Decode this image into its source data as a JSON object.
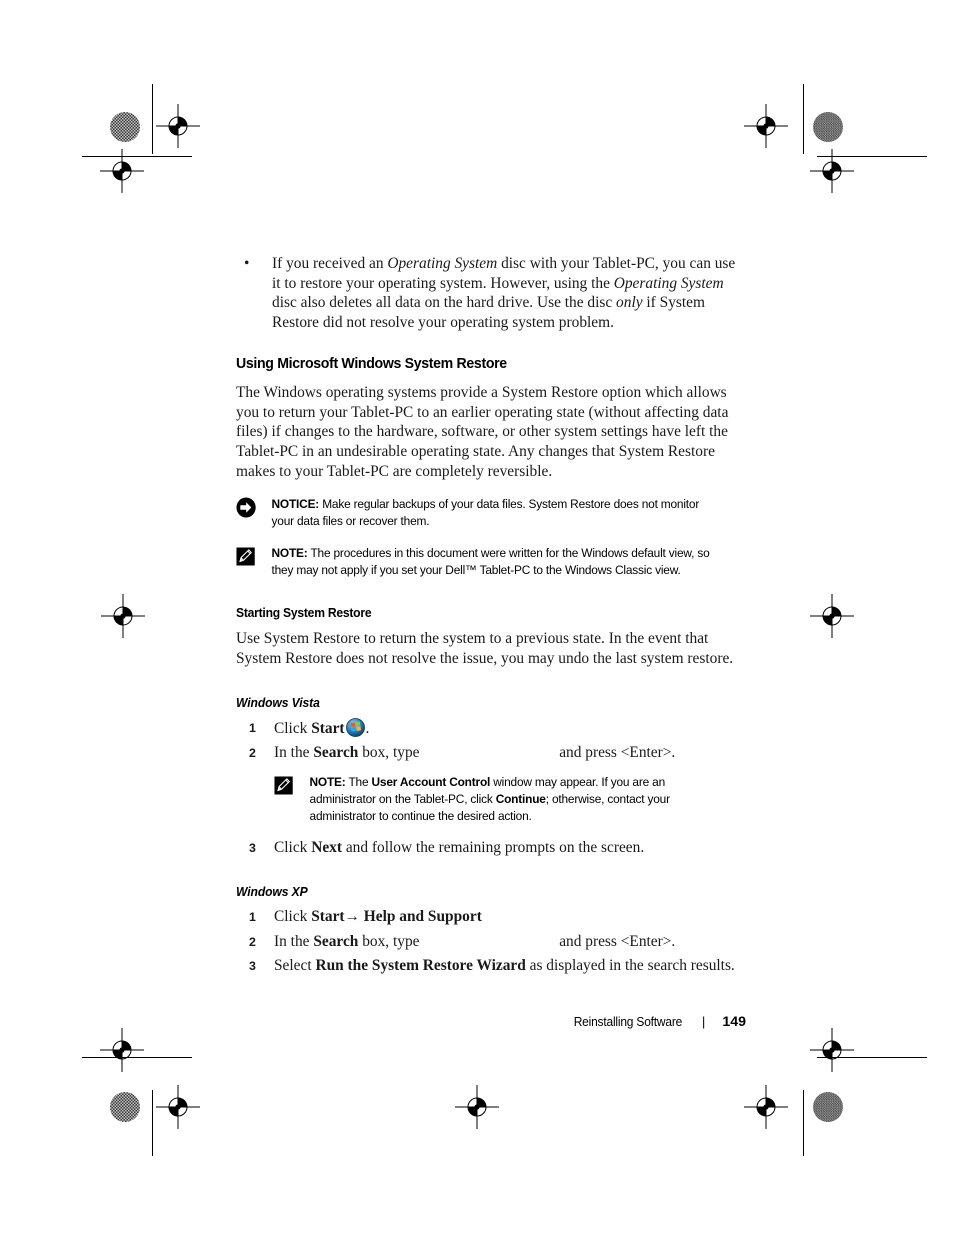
{
  "document": {
    "type": "dell-user-guide-page",
    "footer": {
      "section_title": "Reinstalling Software",
      "separator": "|",
      "page_number": "149"
    }
  },
  "content": {
    "bullets": [
      {
        "marker": "•",
        "runs": [
          {
            "text": "If you received an ",
            "style": "normal"
          },
          {
            "text": "Operating System",
            "style": "italic"
          },
          {
            "text": " disc with your Tablet-PC, you can use it to restore your operating system. However, using the ",
            "style": "normal"
          },
          {
            "text": "Operating System",
            "style": "italic"
          },
          {
            "text": " disc also deletes all data on the hard drive. Use the disc ",
            "style": "normal"
          },
          {
            "text": "only",
            "style": "italic"
          },
          {
            "text": " if System Restore did not resolve your operating system problem.",
            "style": "normal"
          }
        ]
      }
    ],
    "section_heading": "Using Microsoft Windows System Restore",
    "intro_paragraph": "The Windows operating systems provide a System Restore option which allows you to return your Tablet-PC to an earlier operating state (without affecting data files) if changes to the hardware, software, or other system settings have left the Tablet-PC in an undesirable operating state. Any changes that System Restore makes to your Tablet-PC are completely reversible.",
    "notice_callout": {
      "icon": "notice-arrow-icon",
      "label": "NOTICE:",
      "text": " Make regular backups of your data files. System Restore does not monitor your data files or recover them."
    },
    "note_callout": {
      "icon": "note-pencil-icon",
      "label": "NOTE:",
      "text": " The procedures in this document were written for the Windows default view, so they may not apply if you set your Dell™ Tablet-PC to the Windows Classic view."
    },
    "sub_heading": "Starting System Restore",
    "sub_paragraph": "Use System Restore to return the system to a previous state. In the event that System Restore does not resolve the issue, you may undo the last system restore.",
    "vista": {
      "heading": "Windows Vista",
      "steps": [
        {
          "num": "1",
          "runs": [
            {
              "text": "Click ",
              "style": "normal"
            },
            {
              "text": "Start",
              "style": "bold"
            },
            {
              "text": "",
              "style": "vista-orb-icon"
            },
            {
              "text": ".",
              "style": "normal"
            }
          ]
        },
        {
          "num": "2",
          "runs": [
            {
              "text": "In the ",
              "style": "normal"
            },
            {
              "text": "Search",
              "style": "bold"
            },
            {
              "text": " box, type ",
              "style": "normal"
            },
            {
              "text": "",
              "style": "blank-gap"
            },
            {
              "text": " and press <Enter>.",
              "style": "normal"
            }
          ],
          "note": {
            "icon": "note-pencil-icon",
            "label": "NOTE:",
            "runs": [
              {
                "text": " The ",
                "style": "normal"
              },
              {
                "text": "User Account Control",
                "style": "bold"
              },
              {
                "text": " window may appear. If you are an administrator on the Tablet-PC, click ",
                "style": "normal"
              },
              {
                "text": "Continue",
                "style": "bold"
              },
              {
                "text": "; otherwise, contact your administrator to continue the desired action.",
                "style": "normal"
              }
            ]
          }
        },
        {
          "num": "3",
          "runs": [
            {
              "text": "Click ",
              "style": "normal"
            },
            {
              "text": "Next",
              "style": "bold"
            },
            {
              "text": " and follow the remaining prompts on the screen.",
              "style": "normal"
            }
          ]
        }
      ]
    },
    "xp": {
      "heading": "Windows XP",
      "steps": [
        {
          "num": "1",
          "runs": [
            {
              "text": "Click ",
              "style": "normal"
            },
            {
              "text": "Start→ Help and Support",
              "style": "bold"
            }
          ]
        },
        {
          "num": "2",
          "runs": [
            {
              "text": "In the ",
              "style": "normal"
            },
            {
              "text": "Search",
              "style": "bold"
            },
            {
              "text": " box, type ",
              "style": "normal"
            },
            {
              "text": "",
              "style": "blank-gap"
            },
            {
              "text": " and press <Enter>.",
              "style": "normal"
            }
          ]
        },
        {
          "num": "3",
          "runs": [
            {
              "text": "Select ",
              "style": "normal"
            },
            {
              "text": "Run the System Restore Wizard",
              "style": "bold"
            },
            {
              "text": " as displayed in the search results.",
              "style": "normal"
            }
          ]
        }
      ]
    }
  },
  "prepress": {
    "registration_marks": "crosshair-target-icon",
    "density_patches": "halftone-density-patch"
  }
}
